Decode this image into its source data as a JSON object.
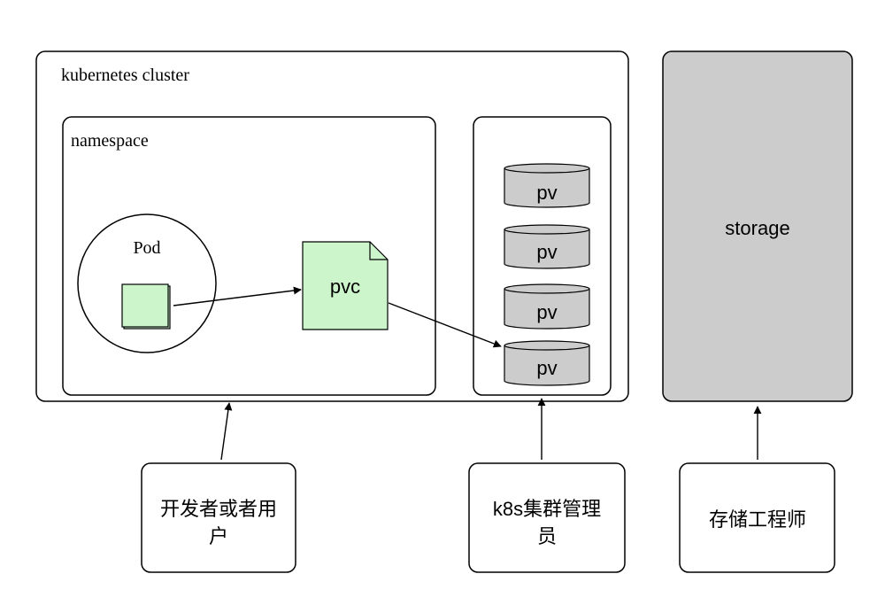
{
  "cluster": {
    "label": "kubernetes cluster"
  },
  "namespace": {
    "label": "namespace"
  },
  "pod": {
    "label": "Pod"
  },
  "pvc": {
    "label": "pvc"
  },
  "pv_list": [
    {
      "label": "pv"
    },
    {
      "label": "pv"
    },
    {
      "label": "pv"
    },
    {
      "label": "pv"
    }
  ],
  "storage": {
    "label": "storage"
  },
  "actors": {
    "developer": {
      "line1": "开发者或者用",
      "line2": "户"
    },
    "admin": {
      "line1": "k8s集群管理",
      "line2": "员"
    },
    "storage_engineer": {
      "line1": "存储工程师"
    }
  },
  "colors": {
    "green_fill": "#ccf5cc",
    "gray_fill": "#cccccc",
    "stroke": "#000000"
  }
}
